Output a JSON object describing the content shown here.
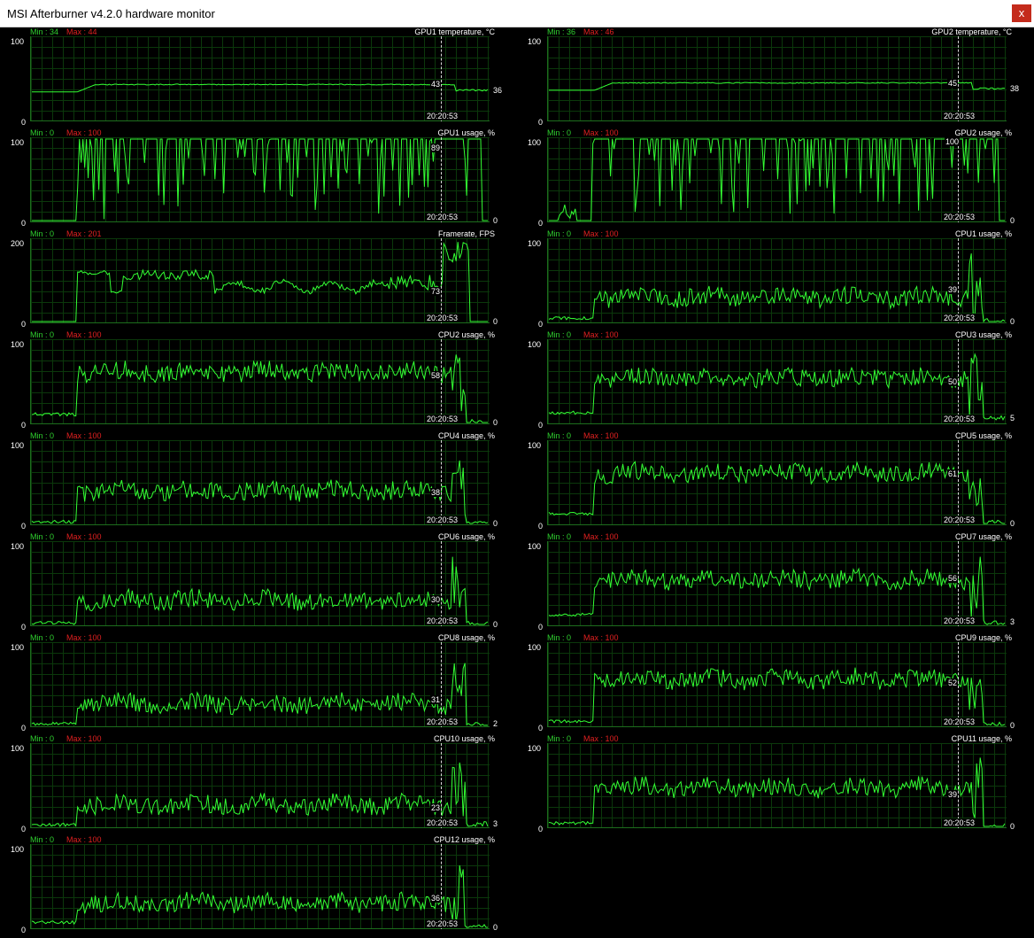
{
  "window": {
    "title": "MSI Afterburner v4.2.0 hardware monitor",
    "close_glyph": "x"
  },
  "colors": {
    "background": "#000000",
    "grid": "#0b380b",
    "line": "#33ff33",
    "min_label": "#2fd02f",
    "max_label": "#e02020",
    "text": "#ffffff",
    "close_button": "#c42b1c"
  },
  "cursor_time": "20:20:53",
  "graphs": [
    {
      "name": "gpu1-temperature",
      "title": "GPU1 temperature, °C",
      "min": "Min : 34",
      "max": "Max : 44",
      "ymax": "100",
      "ymin": "0",
      "cursor_value": "43",
      "current": "36",
      "column": 0,
      "row": 0,
      "max_value": 100,
      "cursor_num": 43,
      "current_num": 36,
      "profile": "temp",
      "base": 34,
      "level": 43,
      "seed": 11
    },
    {
      "name": "gpu2-temperature",
      "title": "GPU2 temperature, °C",
      "min": "Min : 36",
      "max": "Max : 46",
      "ymax": "100",
      "ymin": "0",
      "cursor_value": "45",
      "current": "38",
      "column": 1,
      "row": 0,
      "max_value": 100,
      "cursor_num": 45,
      "current_num": 38,
      "profile": "temp",
      "base": 36,
      "level": 45,
      "seed": 12
    },
    {
      "name": "gpu1-usage",
      "title": "GPU1 usage, %",
      "min": "Min : 0",
      "max": "Max : 100",
      "ymax": "100",
      "ymin": "0",
      "cursor_value": "89",
      "current": "0",
      "column": 0,
      "row": 1,
      "max_value": 100,
      "cursor_num": 89,
      "current_num": 0,
      "profile": "gpu",
      "start": 0.1,
      "seed": 21
    },
    {
      "name": "gpu2-usage",
      "title": "GPU2 usage, %",
      "min": "Min : 0",
      "max": "Max : 100",
      "ymax": "100",
      "ymin": "0",
      "cursor_value": "100",
      "current": "0",
      "column": 1,
      "row": 1,
      "max_value": 100,
      "cursor_num": 100,
      "current_num": 0,
      "profile": "gpu",
      "start": 0.095,
      "seed": 22
    },
    {
      "name": "framerate",
      "title": "Framerate, FPS",
      "min": "Min : 0",
      "max": "Max : 201",
      "ymax": "200",
      "ymin": "0",
      "cursor_value": "73",
      "current": "0",
      "column": 0,
      "row": 2,
      "max_value": 200,
      "cursor_num": 73,
      "current_num": 0,
      "profile": "fps",
      "seed": 31
    },
    {
      "name": "cpu1-usage",
      "title": "CPU1 usage, %",
      "min": "Min : 0",
      "max": "Max : 100",
      "ymax": "100",
      "ymin": "0",
      "cursor_value": "39",
      "current": "0",
      "column": 1,
      "row": 2,
      "max_value": 100,
      "cursor_num": 39,
      "current_num": 0,
      "profile": "cpu",
      "base": 4,
      "level": 30,
      "rise": 0.1,
      "seed": 41
    },
    {
      "name": "cpu2-usage",
      "title": "CPU2 usage, %",
      "min": "Min : 0",
      "max": "Max : 100",
      "ymax": "100",
      "ymin": "0",
      "cursor_value": "58",
      "current": "0",
      "column": 0,
      "row": 3,
      "max_value": 100,
      "cursor_num": 58,
      "current_num": 0,
      "profile": "cpu",
      "base": 10,
      "level": 62,
      "rise": 0.1,
      "seed": 42
    },
    {
      "name": "cpu3-usage",
      "title": "CPU3 usage, %",
      "min": "Min : 0",
      "max": "Max : 100",
      "ymax": "100",
      "ymin": "0",
      "cursor_value": "50",
      "current": "5",
      "column": 1,
      "row": 3,
      "max_value": 100,
      "cursor_num": 50,
      "current_num": 5,
      "profile": "cpu",
      "base": 12,
      "level": 55,
      "rise": 0.1,
      "seed": 43
    },
    {
      "name": "cpu4-usage",
      "title": "CPU4 usage, %",
      "min": "Min : 0",
      "max": "Max : 100",
      "ymax": "100",
      "ymin": "0",
      "cursor_value": "38",
      "current": "0",
      "column": 0,
      "row": 4,
      "max_value": 100,
      "cursor_num": 38,
      "current_num": 0,
      "profile": "cpu",
      "base": 2,
      "level": 40,
      "rise": 0.1,
      "seed": 44
    },
    {
      "name": "cpu5-usage",
      "title": "CPU5 usage, %",
      "min": "Min : 0",
      "max": "Max : 100",
      "ymax": "100",
      "ymin": "0",
      "cursor_value": "61",
      "current": "0",
      "column": 1,
      "row": 4,
      "max_value": 100,
      "cursor_num": 61,
      "current_num": 0,
      "profile": "cpu",
      "base": 12,
      "level": 62,
      "rise": 0.1,
      "seed": 45
    },
    {
      "name": "cpu6-usage",
      "title": "CPU6 usage, %",
      "min": "Min : 0",
      "max": "Max : 100",
      "ymax": "100",
      "ymin": "0",
      "cursor_value": "30",
      "current": "0",
      "column": 0,
      "row": 5,
      "max_value": 100,
      "cursor_num": 30,
      "current_num": 0,
      "profile": "cpu",
      "base": 2,
      "level": 30,
      "rise": 0.1,
      "seed": 46
    },
    {
      "name": "cpu7-usage",
      "title": "CPU7 usage, %",
      "min": "Min : 0",
      "max": "Max : 100",
      "ymax": "100",
      "ymin": "0",
      "cursor_value": "56",
      "current": "3",
      "column": 1,
      "row": 5,
      "max_value": 100,
      "cursor_num": 56,
      "current_num": 3,
      "profile": "cpu",
      "base": 12,
      "level": 55,
      "rise": 0.1,
      "seed": 47
    },
    {
      "name": "cpu8-usage",
      "title": "CPU8 usage, %",
      "min": "Min : 0",
      "max": "Max : 100",
      "ymax": "100",
      "ymin": "0",
      "cursor_value": "31",
      "current": "2",
      "column": 0,
      "row": 6,
      "max_value": 100,
      "cursor_num": 31,
      "current_num": 2,
      "profile": "cpu",
      "base": 2,
      "level": 27,
      "rise": 0.1,
      "seed": 48
    },
    {
      "name": "cpu9-usage",
      "title": "CPU9 usage, %",
      "min": "Min : 0",
      "max": "Max : 100",
      "ymax": "100",
      "ymin": "0",
      "cursor_value": "52",
      "current": "0",
      "column": 1,
      "row": 6,
      "max_value": 100,
      "cursor_num": 52,
      "current_num": 0,
      "profile": "cpu",
      "base": 5,
      "level": 57,
      "rise": 0.1,
      "seed": 49
    },
    {
      "name": "cpu10-usage",
      "title": "CPU10 usage, %",
      "min": "Min : 0",
      "max": "Max : 100",
      "ymax": "100",
      "ymin": "0",
      "cursor_value": "23",
      "current": "3",
      "column": 0,
      "row": 7,
      "max_value": 100,
      "cursor_num": 23,
      "current_num": 3,
      "profile": "cpu",
      "base": 2,
      "level": 27,
      "rise": 0.1,
      "seed": 50
    },
    {
      "name": "cpu11-usage",
      "title": "CPU11 usage, %",
      "min": "Min : 0",
      "max": "Max : 100",
      "ymax": "100",
      "ymin": "0",
      "cursor_value": "39",
      "current": "0",
      "column": 1,
      "row": 7,
      "max_value": 100,
      "cursor_num": 39,
      "current_num": 0,
      "profile": "cpu",
      "base": 4,
      "level": 48,
      "rise": 0.1,
      "seed": 51
    },
    {
      "name": "cpu12-usage",
      "title": "CPU12 usage, %",
      "min": "Min : 0",
      "max": "Max : 100",
      "ymax": "100",
      "ymin": "0",
      "cursor_value": "36",
      "current": "0",
      "column": 0,
      "row": 8,
      "max_value": 100,
      "cursor_num": 36,
      "current_num": 0,
      "profile": "cpu",
      "base": 6,
      "level": 30,
      "rise": 0.1,
      "seed": 52
    }
  ]
}
